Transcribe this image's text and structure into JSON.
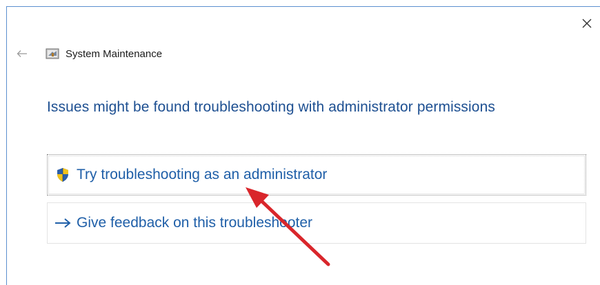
{
  "window": {
    "title": "System Maintenance",
    "close_glyph": "✕",
    "back_icon": "back-arrow-icon",
    "app_icon": "system-maintenance-icon"
  },
  "main": {
    "heading": "Issues might be found troubleshooting with administrator permissions",
    "options": [
      {
        "label": "Try troubleshooting as an administrator",
        "icon": "uac-shield-icon"
      },
      {
        "label": "Give feedback on this troubleshooter",
        "icon": "right-arrow-icon"
      }
    ]
  },
  "annotation": {
    "icon": "red-pointer-arrow",
    "color": "#d9262b"
  },
  "colors": {
    "heading": "#1d4f91",
    "link": "#1f5fa8",
    "window_border": "#5b8fcf"
  }
}
